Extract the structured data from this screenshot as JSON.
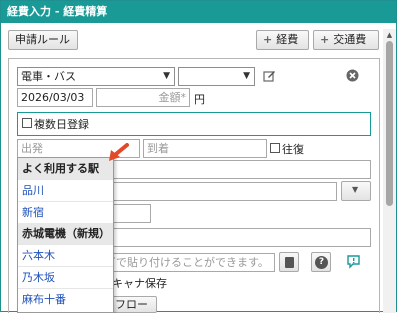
{
  "window": {
    "title": "経費入力 - 経費精算"
  },
  "toolbar": {
    "rules_label": "申請ルール",
    "add_expense_label": "経費",
    "add_transport_label": "交通費"
  },
  "expense_type": {
    "selected": "電車・バス"
  },
  "sub_type": {
    "selected": ""
  },
  "date": {
    "value": "2026/03/03"
  },
  "amount": {
    "placeholder": "金額*",
    "unit": "円"
  },
  "multi_day": {
    "label": "複数日登録"
  },
  "route": {
    "from_placeholder": "出発",
    "to_placeholder": "到着",
    "round_trip_label": "往復"
  },
  "station_dropdown": {
    "frequent_header": "よく利用する駅",
    "frequent": [
      "品川",
      "新宿"
    ],
    "client_header": "赤城電機（新規）",
    "client_stations": [
      "六本木",
      "乃木坂",
      "麻布十番"
    ]
  },
  "attachment": {
    "hint_text": "ビで貼り付けることができます。",
    "scan_label": "キャナ保存",
    "workflow_label": "フロー"
  }
}
